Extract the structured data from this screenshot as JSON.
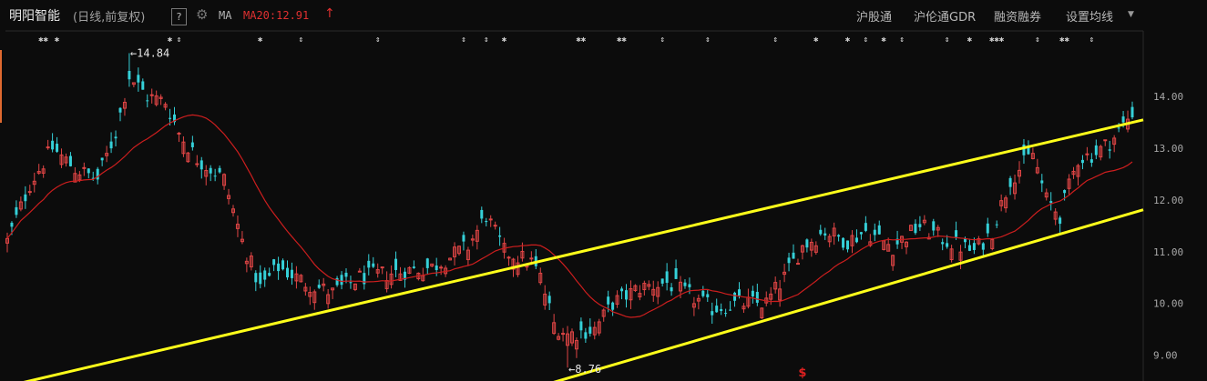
{
  "header": {
    "title": "明阳智能",
    "subtitle": "(日线,前复权)",
    "help": "?",
    "gear_icon": "gear-icon",
    "ma_label": "MA",
    "ma20_text": "MA20:12.91",
    "ma20_arrow": "↑",
    "menu": [
      "沪股通",
      "沪伦通GDR",
      "融资融券",
      "设置均线"
    ],
    "caret_icon": "caret-down-icon"
  },
  "colors": {
    "background": "#0c0c0c",
    "up_candle": "#e04545",
    "down_candle": "#35d0d8",
    "ma_line": "#cc1e1e",
    "channel": "#ffff1a"
  },
  "chart_data": {
    "type": "candlestick",
    "title": "",
    "xlabel": "",
    "ylabel": "",
    "ylim": [
      8.5,
      14.9
    ],
    "y_ticks": [
      "14.00",
      "13.00",
      "12.00",
      "11.00",
      "10.00",
      "9.00"
    ],
    "n_bars": 250,
    "annotations": [
      {
        "label": "←14.84",
        "value": 14.84,
        "bar": 27
      },
      {
        "label": "←8.76",
        "value": 8.76,
        "bar": 124
      }
    ],
    "anchors": [
      [
        0,
        11.2
      ],
      [
        5,
        12.3
      ],
      [
        10,
        13.0
      ],
      [
        15,
        12.6
      ],
      [
        20,
        12.4
      ],
      [
        24,
        13.3
      ],
      [
        27,
        14.4
      ],
      [
        31,
        14.0
      ],
      [
        35,
        13.9
      ],
      [
        38,
        13.3
      ],
      [
        42,
        12.8
      ],
      [
        48,
        12.4
      ],
      [
        52,
        11.2
      ],
      [
        56,
        10.3
      ],
      [
        60,
        10.7
      ],
      [
        66,
        10.4
      ],
      [
        72,
        10.2
      ],
      [
        78,
        10.5
      ],
      [
        86,
        10.6
      ],
      [
        94,
        10.7
      ],
      [
        102,
        11.1
      ],
      [
        106,
        11.7
      ],
      [
        110,
        11.0
      ],
      [
        116,
        10.8
      ],
      [
        118,
        10.5
      ],
      [
        121,
        9.6
      ],
      [
        124,
        9.4
      ],
      [
        130,
        9.5
      ],
      [
        134,
        10.0
      ],
      [
        140,
        10.3
      ],
      [
        146,
        10.4
      ],
      [
        150,
        10.2
      ],
      [
        156,
        9.9
      ],
      [
        162,
        10.0
      ],
      [
        168,
        10.0
      ],
      [
        172,
        10.5
      ],
      [
        176,
        11.1
      ],
      [
        181,
        11.4
      ],
      [
        186,
        11.2
      ],
      [
        190,
        11.4
      ],
      [
        196,
        11.1
      ],
      [
        202,
        11.5
      ],
      [
        208,
        11.2
      ],
      [
        214,
        11.0
      ],
      [
        218,
        11.4
      ],
      [
        222,
        12.4
      ],
      [
        227,
        12.9
      ],
      [
        230,
        12.0
      ],
      [
        233,
        11.7
      ],
      [
        237,
        12.8
      ],
      [
        241,
        12.9
      ],
      [
        245,
        13.2
      ],
      [
        249,
        13.7
      ]
    ],
    "ma20_last": 12.91,
    "channel_lines": [
      {
        "name": "upper",
        "points": [
          [
            0,
            8.4
          ],
          [
            249,
            13.5
          ]
        ]
      },
      {
        "name": "lower",
        "points": [
          [
            118,
            8.4
          ],
          [
            249,
            11.75
          ]
        ]
      }
    ],
    "event_markers": [
      {
        "bar": 8,
        "glyph": "✱✱"
      },
      {
        "bar": 11,
        "glyph": "✱"
      },
      {
        "bar": 36,
        "glyph": "✱"
      },
      {
        "bar": 38,
        "glyph": "⇕"
      },
      {
        "bar": 56,
        "glyph": "✱"
      },
      {
        "bar": 65,
        "glyph": "⇕"
      },
      {
        "bar": 82,
        "glyph": "⇕"
      },
      {
        "bar": 101,
        "glyph": "⇕"
      },
      {
        "bar": 106,
        "glyph": "⇕"
      },
      {
        "bar": 110,
        "glyph": "✱"
      },
      {
        "bar": 127,
        "glyph": "✱✱"
      },
      {
        "bar": 136,
        "glyph": "✱✱"
      },
      {
        "bar": 145,
        "glyph": "⇕"
      },
      {
        "bar": 155,
        "glyph": "⇕"
      },
      {
        "bar": 170,
        "glyph": "⇕"
      },
      {
        "bar": 179,
        "glyph": "✱"
      },
      {
        "bar": 186,
        "glyph": "✱"
      },
      {
        "bar": 190,
        "glyph": "⇕"
      },
      {
        "bar": 194,
        "glyph": "✱"
      },
      {
        "bar": 198,
        "glyph": "⇕"
      },
      {
        "bar": 208,
        "glyph": "⇕"
      },
      {
        "bar": 213,
        "glyph": "✱"
      },
      {
        "bar": 219,
        "glyph": "✱✱✱"
      },
      {
        "bar": 228,
        "glyph": "⇕"
      },
      {
        "bar": 234,
        "glyph": "✱✱"
      },
      {
        "bar": 240,
        "glyph": "⇕"
      }
    ],
    "signal_marker": {
      "bar": 176,
      "label": "$"
    }
  }
}
